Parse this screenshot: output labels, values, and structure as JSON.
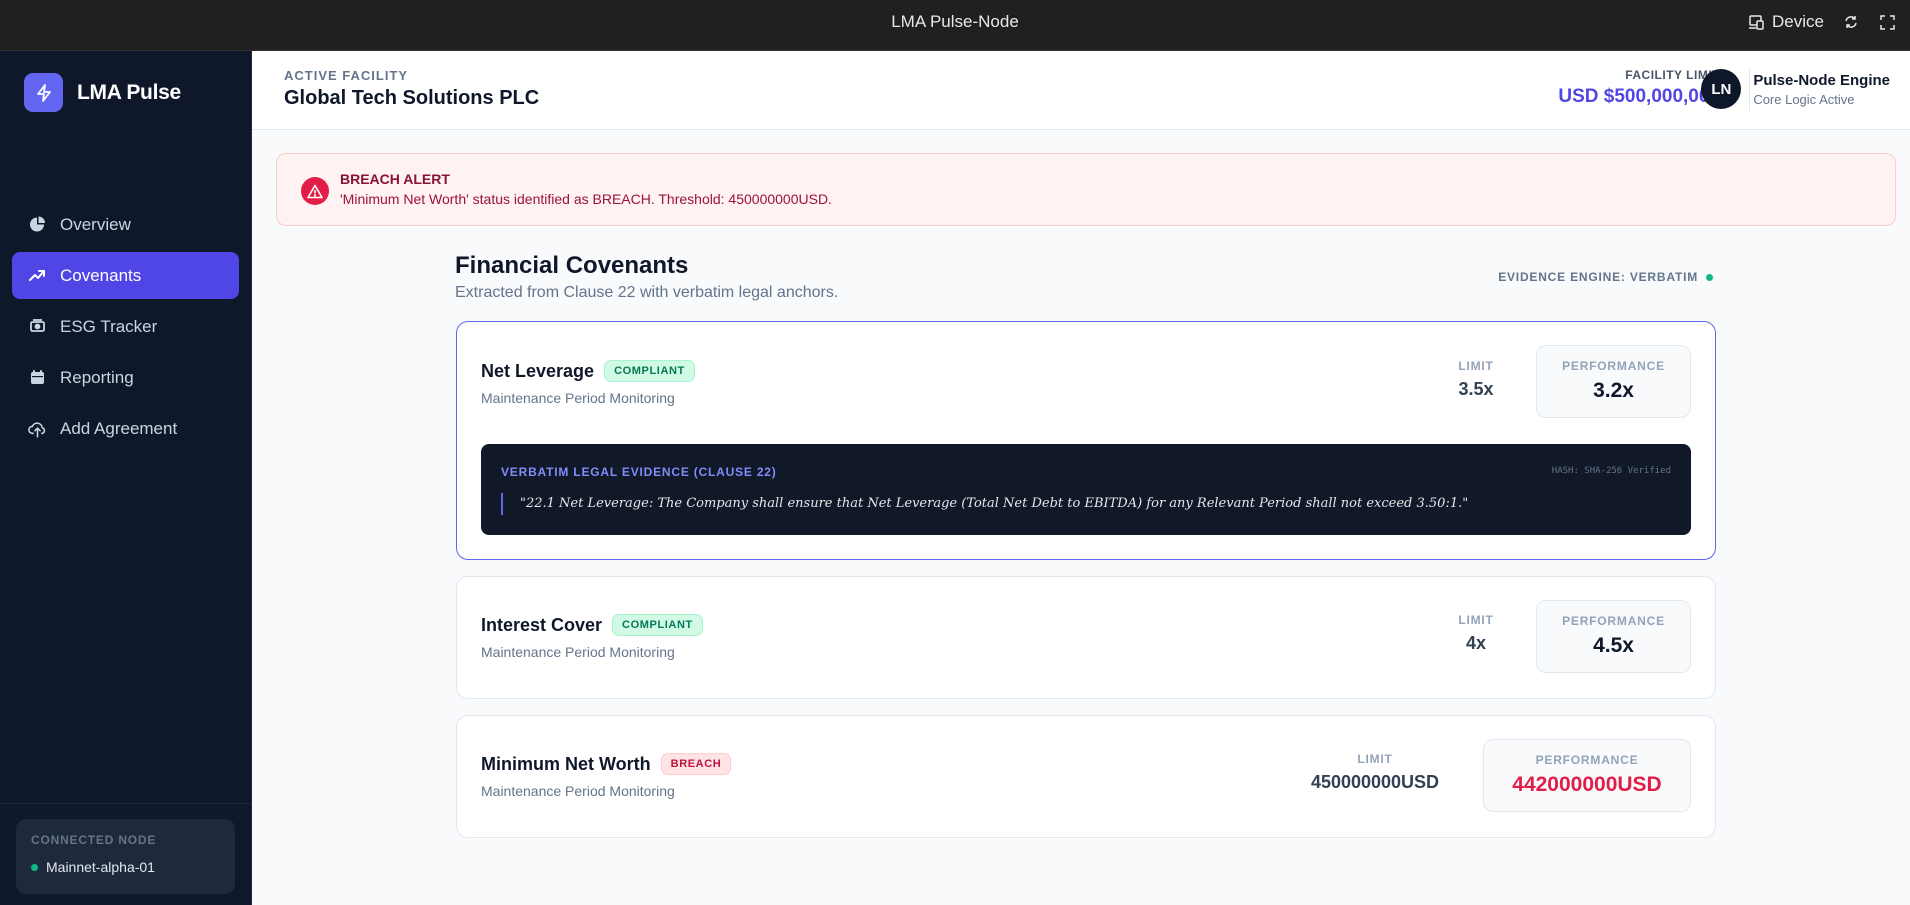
{
  "window": {
    "title": "LMA Pulse-Node",
    "device_label": "Device"
  },
  "sidebar": {
    "brand": "LMA Pulse",
    "items": [
      {
        "label": "Overview",
        "icon": "pie-chart-icon",
        "active": false
      },
      {
        "label": "Covenants",
        "icon": "trending-up-icon",
        "active": true
      },
      {
        "label": "ESG Tracker",
        "icon": "leaf-icon",
        "active": false
      },
      {
        "label": "Reporting",
        "icon": "calendar-icon",
        "active": false
      },
      {
        "label": "Add Agreement",
        "icon": "upload-cloud-icon",
        "active": false
      }
    ],
    "node": {
      "label": "CONNECTED NODE",
      "value": "Mainnet-alpha-01"
    }
  },
  "header": {
    "facility_label": "ACTIVE FACILITY",
    "facility_name": "Global Tech Solutions PLC",
    "limit_label": "FACILITY LIMIT",
    "limit_value": "USD $500,000,000",
    "user_initials": "LN",
    "user_name": "Pulse-Node Engine",
    "user_status": "Core Logic Active"
  },
  "alert": {
    "title": "BREACH ALERT",
    "message": "'Minimum Net Worth' status identified as BREACH. Threshold: 450000000USD."
  },
  "main": {
    "title": "Financial Covenants",
    "subtitle": "Extracted from Clause 22 with verbatim legal anchors.",
    "engine_label": "EVIDENCE ENGINE: VERBATIM",
    "limit_label": "LIMIT",
    "performance_label": "PERFORMANCE",
    "covenants": [
      {
        "name": "Net Leverage",
        "status": "COMPLIANT",
        "subtitle": "Maintenance Period Monitoring",
        "limit": "3.5x",
        "performance": "3.2x",
        "evidence": {
          "title": "VERBATIM LEGAL EVIDENCE (CLAUSE 22)",
          "hash": "HASH: SHA-256 Verified",
          "quote": "\"22.1 Net Leverage: The Company shall ensure that Net Leverage (Total Net Debt to EBITDA) for any Relevant Period shall not exceed 3.50:1.\""
        }
      },
      {
        "name": "Interest Cover",
        "status": "COMPLIANT",
        "subtitle": "Maintenance Period Monitoring",
        "limit": "4x",
        "performance": "4.5x"
      },
      {
        "name": "Minimum Net Worth",
        "status": "BREACH",
        "subtitle": "Maintenance Period Monitoring",
        "limit": "450000000USD",
        "performance": "442000000USD"
      }
    ]
  },
  "colors": {
    "accent": "#4f46e5",
    "sidebar_bg": "#0f172a",
    "breach": "#e11d48",
    "compliant": "#047857"
  }
}
